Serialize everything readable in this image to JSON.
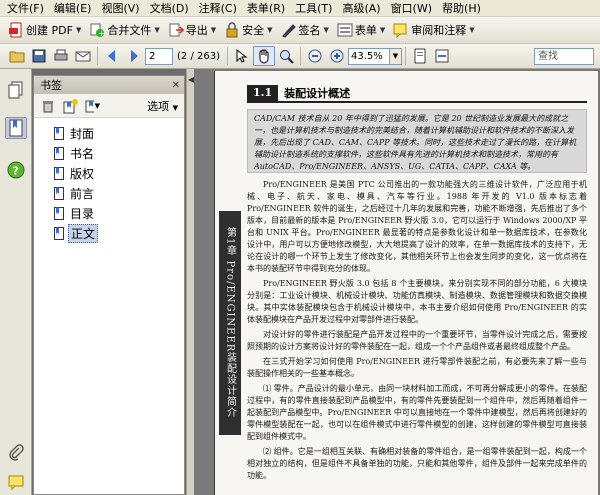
{
  "menubar": {
    "items": [
      "文件(F)",
      "编辑(E)",
      "视图(V)",
      "文档(D)",
      "注释(C)",
      "表单(R)",
      "工具(T)",
      "高级(A)",
      "窗口(W)",
      "帮助(H)"
    ]
  },
  "toolbar1": {
    "create_pdf": "创建 PDF",
    "combine": "合并文件",
    "export": "导出",
    "secure": "安全",
    "sign": "签名",
    "forms": "表单",
    "review": "审阅和注释"
  },
  "toolbar2": {
    "page_number": "2",
    "page_count": "(2 / 263)",
    "zoom": "43.5%",
    "search_placeholder": "查找"
  },
  "bookmarks": {
    "title": "书签",
    "options_label": "选项",
    "items": [
      {
        "label": "封面"
      },
      {
        "label": "书名"
      },
      {
        "label": "版权"
      },
      {
        "label": "前言"
      },
      {
        "label": "目录"
      },
      {
        "label": "正文"
      }
    ]
  },
  "document": {
    "chapter_tab": "第1章 Pro/ENGINEER装配设计简介",
    "section_number": "1.1",
    "section_title": "装配设计概述",
    "abstract": "CAD/CAM 技术自从 20 年中得到了迅猛的发展。它是 20 世纪制造业发展最大的成就之一，也是计算机技术与制造技术的完美结合，随着计算机辅助设计和软件技术的不断深入发展，先后出现了 CAD、CAM、CAPP 等技术。同时，这些技术走过了漫长的路，在计算机辅助设计制造系统的支撑软件，这些软件具有先进的计算机技术和制造技术，常用的有 AutoCAD、Pro/ENGINEER、ANSYS、UG、CATIA、CAPP、CAXA 等。",
    "paragraphs": [
      "Pro/ENGINEER 是美国 PTC 公司推出的一款功能强大的三维设计软件，广泛应用于机械、电子、航天、家电、模具、汽车等行业。1988 年开发的 V1.0 版本标志着 Pro/ENGINEER 软件的诞生，之后经过十几年的发展和完善，功能不断增强，先后推出了多个版本，目前最新的版本是 Pro/ENGINEER 野火版 3.0，它可以运行于 Windows 2000/XP 平台和 UNIX 平台。Pro/ENGINEER 最显著的特点是参数化设计和单一数据库技术，在参数化设计中，用户可以方便地修改模型，大大地提高了设计的效率，在单一数据库技术的支持下，无论在设计的哪一个环节上发生了修改变化，其他相关环节上也会发生同步的变化，这一优点将在本书的装配环节中得到充分的体现。",
      "Pro/ENGINEER 野火版 3.0 包括 8 个主要模块，来分别实现不同的部分功能，6 大模块分别是：工业设计模块、机械设计模块、功能仿真模块、制造模块、数据管理模块和数据交换模块。其中实体装配模块包含于机械设计模块中，本书主要介绍如何使用 Pro/ENGINEER 的实体装配模块在产品开发过程中对零部件进行装配。",
      "对设计好的零件进行装配是产品开发过程中的一个重要环节，当零件设计完成之后，需要按照预期的设计方案将设计好的零件装配在一起，组成一个个产品组件或者最终组成整个产品。",
      "在三式开始学习如何使用 Pro/ENGINEER 进行零部件装配之前，有必要先来了解一些与装配操作相关的一些基本概念。",
      "⑴ 零件。产品设计的最小单元，由同一块材料加工而成，不可再分解成更小的零件。在装配过程中，有的零件直接装配到产品模型中，有的零件先要装配到一个组件中，然后再随着组件一起装配到产品模型中。Pro/ENGINEER 中可以直接地在一个零件中建模型，然后再将创建好的零件模型装配在一起，也可以在组件模式中进行零件模型的创建，这样创建的零件模型可直接装配到组件模式中。",
      "⑵ 组件。它是一组相互关联、有确相对装备的零件组合，是一组零件装配到一起，构成一个相对独立的结构，但是组件不具备单独的功能，只能和其他零件，组件及部件一起来完成单件的功能。"
    ]
  },
  "colors": {
    "chrome": "#ece9d8",
    "selection": "#c6d2ea",
    "abstract_bg": "#d9d9d9",
    "page_bg": "#f7f6f2"
  }
}
